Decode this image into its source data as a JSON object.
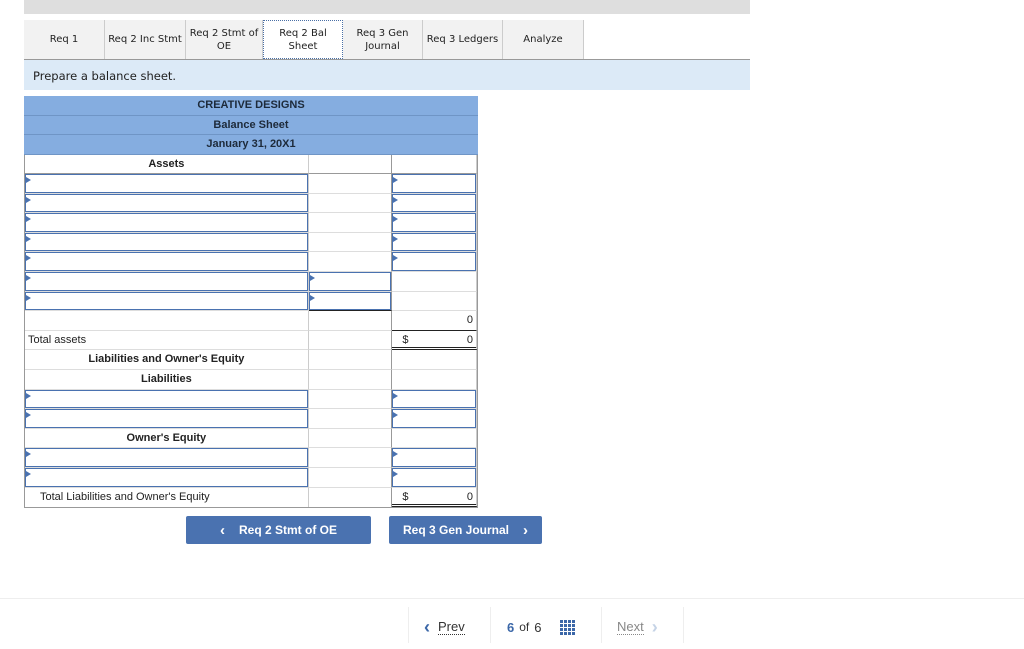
{
  "tabs": [
    {
      "label": "Req 1",
      "active": false
    },
    {
      "label": "Req 2 Inc Stmt",
      "active": false
    },
    {
      "label": "Req 2 Stmt of OE",
      "active": false
    },
    {
      "label": "Req 2 Bal Sheet",
      "active": true
    },
    {
      "label": "Req 3 Gen Journal",
      "active": false
    },
    {
      "label": "Req 3 Ledgers",
      "active": false
    },
    {
      "label": "Analyze",
      "active": false
    }
  ],
  "instruction": "Prepare a balance sheet.",
  "sheet": {
    "company": "CREATIVE DESIGNS",
    "title": "Balance Sheet",
    "date": "January 31, 20X1",
    "assets_heading": "Assets",
    "subtotal_value": "0",
    "total_assets_label": "Total assets",
    "total_assets_currency": "$",
    "total_assets_value": "0",
    "liab_oe_heading": "Liabilities and Owner's Equity",
    "liabilities_heading": "Liabilities",
    "owners_equity_heading": "Owner's Equity",
    "total_liab_oe_label": "Total Liabilities and Owner's Equity",
    "total_liab_oe_currency": "$",
    "total_liab_oe_value": "0"
  },
  "nav": {
    "prev_label": "Req 2 Stmt of OE",
    "next_label": "Req 3 Gen Journal",
    "prev_chevron": "‹",
    "next_chevron": "›"
  },
  "pager": {
    "prev": "Prev",
    "current": "6",
    "of": "of",
    "total": "6",
    "next": "Next"
  }
}
